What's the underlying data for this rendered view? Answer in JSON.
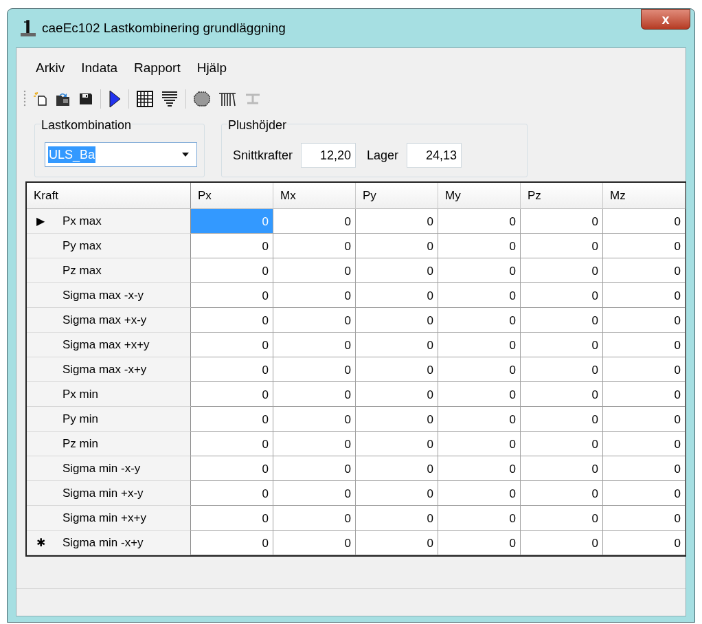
{
  "window": {
    "title": "caeEc102 Lastkombinering grundläggning",
    "close": "x"
  },
  "menu": [
    {
      "label": "Arkiv"
    },
    {
      "label": "Indata"
    },
    {
      "label": "Rapport"
    },
    {
      "label": "Hjälp"
    }
  ],
  "toolbar": [
    {
      "kind": "new"
    },
    {
      "kind": "open"
    },
    {
      "kind": "save"
    },
    {
      "kind": "separator"
    },
    {
      "kind": "run"
    },
    {
      "kind": "separator"
    },
    {
      "kind": "grid"
    },
    {
      "kind": "layers"
    },
    {
      "kind": "separator"
    },
    {
      "kind": "circle"
    },
    {
      "kind": "columns"
    },
    {
      "kind": "beam",
      "disabled": true
    }
  ],
  "lastkombination": {
    "label": "Lastkombination",
    "value": "ULS_Ba"
  },
  "plushojder": {
    "label": "Plushöjder",
    "fields": [
      {
        "label": "Snittkrafter",
        "value": "12,20"
      },
      {
        "label": "Lager",
        "value": "24,13"
      }
    ]
  },
  "table": {
    "columns": [
      "Kraft",
      "Px",
      "Mx",
      "Py",
      "My",
      "Pz",
      "Mz"
    ],
    "rows": [
      {
        "marker": "▶",
        "label": "Px max",
        "cells": [
          {
            "value": "0",
            "selected": true
          },
          {
            "value": "0",
            "selected": false
          },
          {
            "value": "0",
            "selected": false
          },
          {
            "value": "0",
            "selected": false
          },
          {
            "value": "0",
            "selected": false
          },
          {
            "value": "0",
            "selected": false
          }
        ]
      },
      {
        "label": "Py max",
        "cells": [
          {
            "value": "0",
            "selected": false
          },
          {
            "value": "0",
            "selected": false
          },
          {
            "value": "0",
            "selected": false
          },
          {
            "value": "0",
            "selected": false
          },
          {
            "value": "0",
            "selected": false
          },
          {
            "value": "0",
            "selected": false
          }
        ]
      },
      {
        "label": "Pz max",
        "cells": [
          {
            "value": "0",
            "selected": false
          },
          {
            "value": "0",
            "selected": false
          },
          {
            "value": "0",
            "selected": false
          },
          {
            "value": "0",
            "selected": false
          },
          {
            "value": "0",
            "selected": false
          },
          {
            "value": "0",
            "selected": false
          }
        ]
      },
      {
        "label": "Sigma max -x-y",
        "cells": [
          {
            "value": "0",
            "selected": false
          },
          {
            "value": "0",
            "selected": false
          },
          {
            "value": "0",
            "selected": false
          },
          {
            "value": "0",
            "selected": false
          },
          {
            "value": "0",
            "selected": false
          },
          {
            "value": "0",
            "selected": false
          }
        ]
      },
      {
        "label": "Sigma max +x-y",
        "cells": [
          {
            "value": "0",
            "selected": false
          },
          {
            "value": "0",
            "selected": false
          },
          {
            "value": "0",
            "selected": false
          },
          {
            "value": "0",
            "selected": false
          },
          {
            "value": "0",
            "selected": false
          },
          {
            "value": "0",
            "selected": false
          }
        ]
      },
      {
        "label": "Sigma max +x+y",
        "cells": [
          {
            "value": "0",
            "selected": false
          },
          {
            "value": "0",
            "selected": false
          },
          {
            "value": "0",
            "selected": false
          },
          {
            "value": "0",
            "selected": false
          },
          {
            "value": "0",
            "selected": false
          },
          {
            "value": "0",
            "selected": false
          }
        ]
      },
      {
        "label": "Sigma max -x+y",
        "cells": [
          {
            "value": "0",
            "selected": false
          },
          {
            "value": "0",
            "selected": false
          },
          {
            "value": "0",
            "selected": false
          },
          {
            "value": "0",
            "selected": false
          },
          {
            "value": "0",
            "selected": false
          },
          {
            "value": "0",
            "selected": false
          }
        ]
      },
      {
        "label": "Px min",
        "cells": [
          {
            "value": "0",
            "selected": false
          },
          {
            "value": "0",
            "selected": false
          },
          {
            "value": "0",
            "selected": false
          },
          {
            "value": "0",
            "selected": false
          },
          {
            "value": "0",
            "selected": false
          },
          {
            "value": "0",
            "selected": false
          }
        ]
      },
      {
        "label": "Py min",
        "cells": [
          {
            "value": "0",
            "selected": false
          },
          {
            "value": "0",
            "selected": false
          },
          {
            "value": "0",
            "selected": false
          },
          {
            "value": "0",
            "selected": false
          },
          {
            "value": "0",
            "selected": false
          },
          {
            "value": "0",
            "selected": false
          }
        ]
      },
      {
        "label": "Pz min",
        "cells": [
          {
            "value": "0",
            "selected": false
          },
          {
            "value": "0",
            "selected": false
          },
          {
            "value": "0",
            "selected": false
          },
          {
            "value": "0",
            "selected": false
          },
          {
            "value": "0",
            "selected": false
          },
          {
            "value": "0",
            "selected": false
          }
        ]
      },
      {
        "label": "Sigma min -x-y",
        "cells": [
          {
            "value": "0",
            "selected": false
          },
          {
            "value": "0",
            "selected": false
          },
          {
            "value": "0",
            "selected": false
          },
          {
            "value": "0",
            "selected": false
          },
          {
            "value": "0",
            "selected": false
          },
          {
            "value": "0",
            "selected": false
          }
        ]
      },
      {
        "label": "Sigma min +x-y",
        "cells": [
          {
            "value": "0",
            "selected": false
          },
          {
            "value": "0",
            "selected": false
          },
          {
            "value": "0",
            "selected": false
          },
          {
            "value": "0",
            "selected": false
          },
          {
            "value": "0",
            "selected": false
          },
          {
            "value": "0",
            "selected": false
          }
        ]
      },
      {
        "label": "Sigma min +x+y",
        "cells": [
          {
            "value": "0",
            "selected": false
          },
          {
            "value": "0",
            "selected": false
          },
          {
            "value": "0",
            "selected": false
          },
          {
            "value": "0",
            "selected": false
          },
          {
            "value": "0",
            "selected": false
          },
          {
            "value": "0",
            "selected": false
          }
        ]
      },
      {
        "marker": "✱",
        "label": "Sigma min -x+y",
        "cells": [
          {
            "value": "0",
            "selected": false
          },
          {
            "value": "0",
            "selected": false
          },
          {
            "value": "0",
            "selected": false
          },
          {
            "value": "0",
            "selected": false
          },
          {
            "value": "0",
            "selected": false
          },
          {
            "value": "0",
            "selected": false
          }
        ]
      }
    ]
  }
}
